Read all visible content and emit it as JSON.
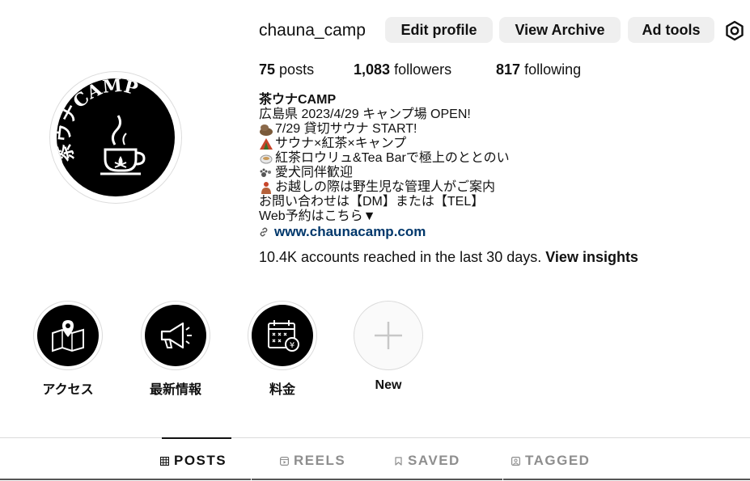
{
  "profile": {
    "username": "chauna_camp",
    "avatar_text": "茶ウナCAMP",
    "buttons": {
      "edit_profile": "Edit profile",
      "view_archive": "View Archive",
      "ad_tools": "Ad tools"
    },
    "settings_icon": "gear-icon",
    "stats": {
      "posts_count": "75",
      "posts_label": "posts",
      "followers_count": "1,083",
      "followers_label": "followers",
      "following_count": "817",
      "following_label": "following"
    },
    "bio": {
      "name": "茶ウナCAMP",
      "lines": [
        "広島県 2023/4/29 キャンプ場 OPEN!",
        "7/29 貸切サウナ START!",
        "サウナ×紅茶×キャンプ",
        "紅茶ロウリュ&Tea Barで極上のととのい",
        "愛犬同伴歓迎",
        "お越しの際は野生児な管理人がご案内",
        "お問い合わせは【DM】または【TEL】",
        "Web予約はこちら▼"
      ],
      "link": "www.chaunacamp.com"
    },
    "insights": {
      "text": "10.4K accounts reached in the last 30 days.",
      "link_label": "View insights"
    }
  },
  "highlights": [
    {
      "label": "アクセス",
      "icon": "map-pin-icon"
    },
    {
      "label": "最新情報",
      "icon": "megaphone-icon"
    },
    {
      "label": "料金",
      "icon": "calendar-price-icon"
    },
    {
      "label": "New",
      "icon": "plus-icon"
    }
  ],
  "tabs": [
    {
      "label": "POSTS",
      "icon": "grid-icon",
      "active": true
    },
    {
      "label": "REELS",
      "icon": "reels-icon",
      "active": false
    },
    {
      "label": "SAVED",
      "icon": "bookmark-icon",
      "active": false
    },
    {
      "label": "TAGGED",
      "icon": "tag-icon",
      "active": false
    }
  ],
  "colors": {
    "text": "#111111",
    "link": "#00376b",
    "button_bg": "#efefef",
    "muted": "#8e8e8e"
  }
}
